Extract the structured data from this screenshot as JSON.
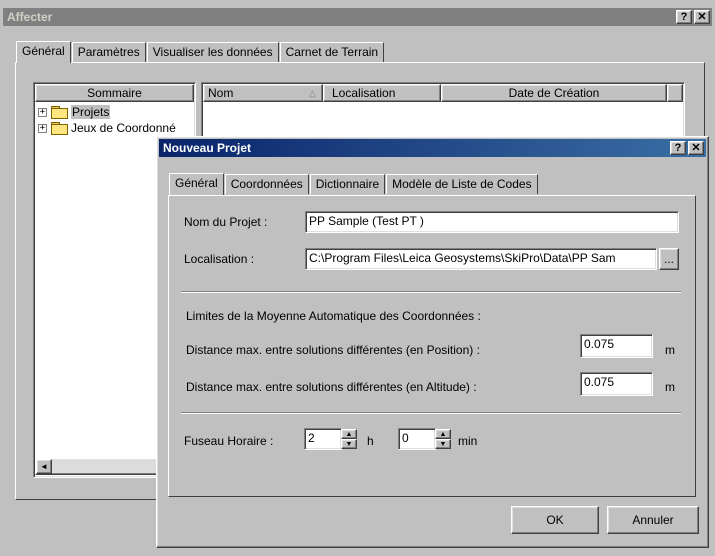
{
  "parent": {
    "title": "Affecter",
    "help_btn": "?",
    "close_btn": "✕",
    "tabs": [
      "Général",
      "Paramètres",
      "Visualiser les données",
      "Carnet de Terrain"
    ],
    "tree_header": "Sommaire",
    "tree_items": [
      "Projets",
      "Jeux de Coordonné"
    ],
    "columns": [
      "Nom",
      "Localisation",
      "Date de Création"
    ],
    "scroll_left": "◄"
  },
  "dialog": {
    "title": "Nouveau Projet",
    "help_btn": "?",
    "close_btn": "✕",
    "tabs": [
      "Général",
      "Coordonnées",
      "Dictionnaire",
      "Modèle de Liste de Codes"
    ],
    "name_label": "Nom du Projet :",
    "name_value": "PP Sample (Test PT )",
    "location_label": "Localisation :",
    "location_value": "C:\\Program Files\\Leica Geosystems\\SkiPro\\Data\\PP Sam",
    "browse_btn": "...",
    "limits_heading": "Limites de la Moyenne Automatique des Coordonnées :",
    "pos_label": "Distance max. entre solutions différentes (en Position) :",
    "pos_value": "0.075",
    "pos_unit": "m",
    "alt_label": "Distance max. entre solutions différentes (en Altitude) :",
    "alt_value": "0.075",
    "alt_unit": "m",
    "tz_label": "Fuseau Horaire :",
    "tz_hours": "2",
    "tz_hours_unit": "h",
    "tz_minutes": "0",
    "tz_minutes_unit": "min",
    "ok": "OK",
    "cancel": "Annuler"
  }
}
